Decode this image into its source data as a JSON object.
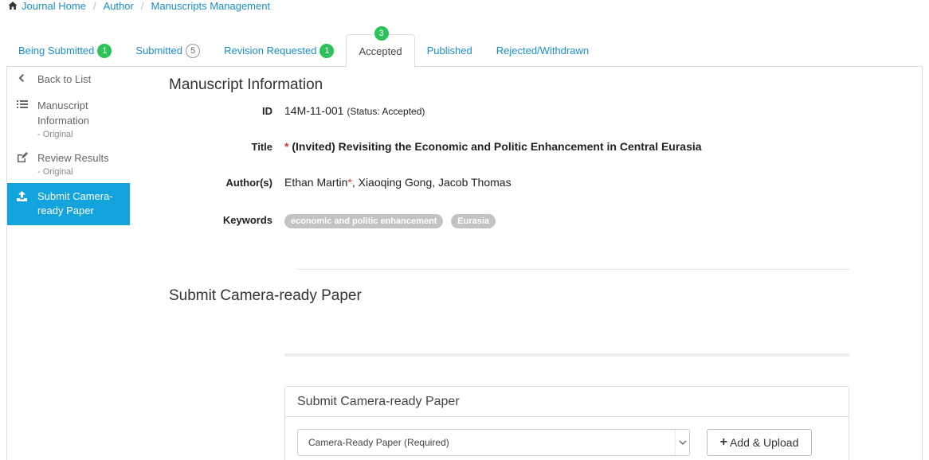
{
  "breadcrumb": {
    "items": [
      "Journal Home",
      "Author",
      "Manuscripts Management"
    ],
    "separator": "/"
  },
  "tabs": [
    {
      "label": "Being Submitted",
      "badge": "1"
    },
    {
      "label": "Submitted",
      "badge": "5"
    },
    {
      "label": "Revision Requested",
      "badge": "1"
    },
    {
      "label": "Accepted",
      "badge": "3"
    },
    {
      "label": "Published",
      "badge": ""
    },
    {
      "label": "Rejected/Withdrawn",
      "badge": ""
    }
  ],
  "sidebar": {
    "items": [
      {
        "label": "Back to List",
        "sub": "",
        "icon": "chevron-left-icon"
      },
      {
        "label": "Manuscript Information",
        "sub": "- Original",
        "icon": "list-icon"
      },
      {
        "label": "Review Results",
        "sub": "- Original",
        "icon": "edit-icon"
      },
      {
        "label": "Submit Camera-ready Paper",
        "sub": "",
        "icon": "upload-icon",
        "active": true
      }
    ]
  },
  "manuscript": {
    "heading": "Manuscript Information",
    "id_label": "ID",
    "id_value": "14M-11-001",
    "status": "(Status: Accepted)",
    "title_label": "Title",
    "title_marker": "*",
    "title_value": "(Invited) Revisiting the Economic and Politic Enhancement in Central Eurasia",
    "authors_label": "Author(s)",
    "author_first": "Ethan Martin",
    "author_marker": "*",
    "author_rest": ", Xiaoqing Gong, Jacob Thomas",
    "keywords_label": "Keywords",
    "keywords": [
      "economic and politic enhancement",
      "Eurasia"
    ]
  },
  "submit_section": {
    "heading": "Submit Camera-ready Paper",
    "panel_title": "Submit Camera-ready Paper",
    "select_value": "Camera-Ready Paper (Required)",
    "upload_label": "Add & Upload"
  },
  "colors": {
    "link": "#1a8fcf",
    "badge_green": "#2cc25a",
    "sidebar_active": "#13a4dd",
    "required": "#d33333"
  }
}
